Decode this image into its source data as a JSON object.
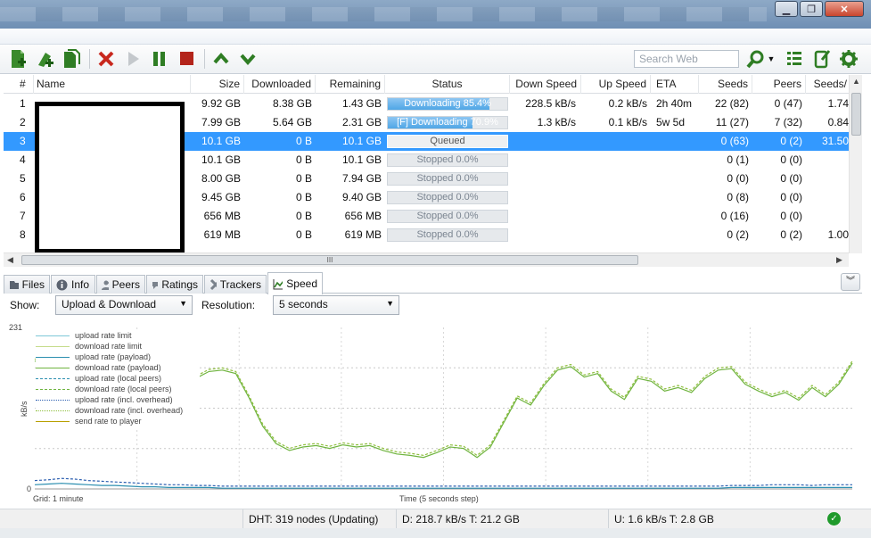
{
  "toolbar": {
    "search_placeholder": "Search Web"
  },
  "table": {
    "columns": [
      "#",
      "Name",
      "Size",
      "Downloaded",
      "Remaining",
      "Status",
      "Down Speed",
      "Up Speed",
      "ETA",
      "Seeds",
      "Peers",
      "Seeds/"
    ],
    "rows": [
      {
        "num": "1",
        "size": "9.92 GB",
        "downloaded": "8.38 GB",
        "remaining": "1.43 GB",
        "status": "Downloading 85.4%",
        "progress": 85.4,
        "state": "downloading",
        "down": "228.5 kB/s",
        "up": "0.2 kB/s",
        "eta": "2h 40m",
        "seeds": "22 (82)",
        "peers": "0 (47)",
        "ratio": "1.74"
      },
      {
        "num": "2",
        "size": "7.99 GB",
        "downloaded": "5.64 GB",
        "remaining": "2.31 GB",
        "status": "[F] Downloading 70.9%",
        "progress": 70.9,
        "state": "downloading",
        "down": "1.3 kB/s",
        "up": "0.1 kB/s",
        "eta": "5w 5d",
        "seeds": "11 (27)",
        "peers": "7 (32)",
        "ratio": "0.84"
      },
      {
        "num": "3",
        "size": "10.1 GB",
        "downloaded": "0 B",
        "remaining": "10.1 GB",
        "status": "Queued",
        "progress": 0,
        "state": "queued",
        "down": "",
        "up": "",
        "eta": "",
        "seeds": "0 (63)",
        "peers": "0 (2)",
        "ratio": "31.50"
      },
      {
        "num": "4",
        "size": "10.1 GB",
        "downloaded": "0 B",
        "remaining": "10.1 GB",
        "status": "Stopped 0.0%",
        "progress": 0,
        "state": "stopped",
        "down": "",
        "up": "",
        "eta": "",
        "seeds": "0 (1)",
        "peers": "0 (0)",
        "ratio": ""
      },
      {
        "num": "5",
        "size": "8.00 GB",
        "downloaded": "0 B",
        "remaining": "7.94 GB",
        "status": "Stopped 0.0%",
        "progress": 0,
        "state": "stopped",
        "down": "",
        "up": "",
        "eta": "",
        "seeds": "0 (0)",
        "peers": "0 (0)",
        "ratio": ""
      },
      {
        "num": "6",
        "size": "9.45 GB",
        "downloaded": "0 B",
        "remaining": "9.40 GB",
        "status": "Stopped 0.0%",
        "progress": 0,
        "state": "stopped",
        "down": "",
        "up": "",
        "eta": "",
        "seeds": "0 (8)",
        "peers": "0 (0)",
        "ratio": ""
      },
      {
        "num": "7",
        "size": "656 MB",
        "downloaded": "0 B",
        "remaining": "656 MB",
        "status": "Stopped 0.0%",
        "progress": 0,
        "state": "stopped",
        "down": "",
        "up": "",
        "eta": "",
        "seeds": "0 (16)",
        "peers": "0 (0)",
        "ratio": ""
      },
      {
        "num": "8",
        "size": "619 MB",
        "downloaded": "0 B",
        "remaining": "619 MB",
        "status": "Stopped 0.0%",
        "progress": 0,
        "state": "stopped",
        "down": "",
        "up": "",
        "eta": "",
        "seeds": "0 (2)",
        "peers": "0 (2)",
        "ratio": "1.00"
      }
    ],
    "selected_row": 3,
    "scroll_marker": "III"
  },
  "tabs": [
    "Files",
    "Info",
    "Peers",
    "Ratings",
    "Trackers",
    "Speed"
  ],
  "speed_panel": {
    "show_label": "Show:",
    "show_value": "Upload & Download",
    "resolution_label": "Resolution:",
    "resolution_value": "5 seconds",
    "y_max": "231",
    "y_min": "0",
    "y_unit": "kB/s",
    "grid_label": "Grid: 1 minute",
    "x_label": "Time (5 seconds step)",
    "legend": [
      {
        "name": "upload rate limit",
        "color": "#7ec8d8",
        "style": "solid"
      },
      {
        "name": "download rate limit",
        "color": "#c5dc8a",
        "style": "solid"
      },
      {
        "name": "upload rate (payload)",
        "color": "#2c8fb0",
        "style": "solid"
      },
      {
        "name": "download rate (payload)",
        "color": "#6fb43f",
        "style": "solid"
      },
      {
        "name": "upload rate (local peers)",
        "color": "#2c8fb0",
        "style": "dashed"
      },
      {
        "name": "download rate (local peers)",
        "color": "#6fb43f",
        "style": "dashed"
      },
      {
        "name": "upload rate (incl. overhead)",
        "color": "#2c5fb0",
        "style": "dotted"
      },
      {
        "name": "download rate (incl. overhead)",
        "color": "#8fbf3f",
        "style": "dotted"
      },
      {
        "name": "send rate to player",
        "color": "#b8a000",
        "style": "solid"
      }
    ]
  },
  "chart_data": {
    "type": "line",
    "ylabel": "kB/s",
    "xlabel": "Time (5 seconds step)",
    "ylim": [
      0,
      231
    ],
    "series": [
      {
        "name": "download rate (payload)",
        "values": [
          183,
          175,
          200,
          190,
          155,
          158,
          160,
          148,
          155,
          140,
          154,
          148,
          158,
          168,
          170,
          165,
          130,
          90,
          65,
          55,
          60,
          62,
          58,
          63,
          60,
          62,
          55,
          50,
          48,
          45,
          52,
          60,
          58,
          45,
          60,
          95,
          130,
          120,
          148,
          170,
          175,
          160,
          165,
          140,
          128,
          158,
          154,
          140,
          145,
          138,
          158,
          170,
          172,
          150,
          140,
          132,
          138,
          127,
          145,
          132,
          150,
          180
        ]
      },
      {
        "name": "download rate (incl. overhead)",
        "values": [
          186,
          178,
          203,
          193,
          158,
          161,
          163,
          151,
          158,
          143,
          157,
          151,
          161,
          171,
          173,
          168,
          133,
          93,
          68,
          58,
          63,
          65,
          61,
          66,
          63,
          65,
          58,
          53,
          51,
          48,
          55,
          63,
          61,
          48,
          63,
          98,
          133,
          123,
          151,
          173,
          178,
          163,
          168,
          143,
          131,
          161,
          157,
          143,
          148,
          141,
          161,
          173,
          175,
          153,
          143,
          135,
          141,
          130,
          148,
          135,
          153,
          183
        ]
      },
      {
        "name": "upload rate (incl. overhead)",
        "values": [
          12,
          13,
          15,
          14,
          12,
          11,
          10,
          9,
          8,
          7,
          6,
          6,
          5,
          5,
          4,
          4,
          4,
          4,
          4,
          4,
          4,
          4,
          4,
          4,
          4,
          4,
          4,
          4,
          4,
          4,
          4,
          4,
          4,
          4,
          4,
          4,
          4,
          4,
          4,
          4,
          4,
          4,
          4,
          4,
          4,
          4,
          4,
          4,
          4,
          4,
          4,
          4,
          5,
          5,
          5,
          6,
          6,
          6,
          5,
          6,
          6,
          6
        ]
      },
      {
        "name": "upload rate (payload)",
        "values": [
          6,
          7,
          8,
          7,
          6,
          5,
          5,
          4,
          3,
          3,
          2,
          2,
          2,
          2,
          1,
          1,
          1,
          1,
          1,
          1,
          1,
          1,
          1,
          1,
          1,
          1,
          1,
          1,
          1,
          1,
          1,
          1,
          1,
          1,
          1,
          1,
          1,
          1,
          1,
          1,
          1,
          1,
          1,
          1,
          1,
          1,
          1,
          1,
          1,
          1,
          1,
          1,
          2,
          2,
          2,
          2,
          2,
          2,
          2,
          2,
          2,
          2
        ]
      }
    ]
  },
  "statusbar": {
    "dht": "DHT: 319 nodes (Updating)",
    "down": "D: 218.7 kB/s T: 21.2 GB",
    "up": "U: 1.6 kB/s T: 2.8 GB"
  }
}
